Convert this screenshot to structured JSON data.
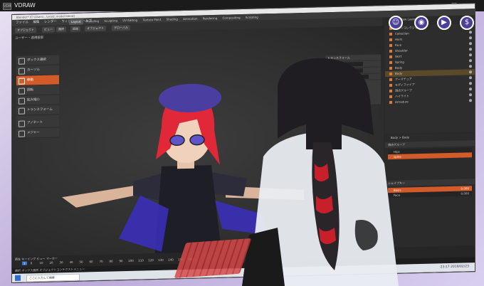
{
  "window": {
    "title": "VDRAW",
    "icon_label": "VDR"
  },
  "controls": {
    "minimize": "—",
    "maximize": "□",
    "close": "✕"
  },
  "blender": {
    "file_title": "Blender* [C:\\Users\\...\\vroid_model.blend]",
    "menu": [
      "ファイル",
      "編集",
      "レンダー",
      "ウィンドウ",
      "ヘルプ"
    ],
    "workspace_tabs": [
      "Layout",
      "Modeling",
      "Sculpting",
      "UV Editing",
      "Texture Paint",
      "Shading",
      "Animation",
      "Rendering",
      "Compositing",
      "Scripting"
    ],
    "active_tab": "Layout",
    "header": {
      "mode": "オブジェクト",
      "view": "ビュー",
      "select": "選択",
      "add": "追加",
      "object": "オブジェクト",
      "global": "グローバル",
      "scene": "Scene",
      "view_layer": "View Layer"
    },
    "viewport_info": "ユーザー・透視投影",
    "tools": [
      {
        "label": "ボックス選択",
        "active": false
      },
      {
        "label": "カーソル",
        "active": false
      },
      {
        "label": "移動",
        "active": true
      },
      {
        "label": "回転",
        "active": false
      },
      {
        "label": "拡大縮小",
        "active": false
      },
      {
        "label": "トランスフォーム",
        "active": false
      },
      {
        "label": "アノテート",
        "active": false
      },
      {
        "label": "メジャー",
        "active": false
      }
    ],
    "npanel": {
      "title": "トランスフォーム",
      "row1": "位置",
      "row2": "回転",
      "row3": "スケール"
    },
    "outliner": [
      {
        "label": "シーンコレクション",
        "sel": false
      },
      {
        "label": "Collection",
        "sel": false
      },
      {
        "label": "Hairs",
        "sel": false
      },
      {
        "label": "Face",
        "sel": false
      },
      {
        "label": "Shoulder",
        "sel": false
      },
      {
        "label": "Skirt",
        "sel": false
      },
      {
        "label": "Spring",
        "sel": false
      },
      {
        "label": "Body",
        "sel": false
      },
      {
        "label": "Body",
        "sel": true
      },
      {
        "label": "アーマチュア",
        "sel": false
      },
      {
        "label": "モディファイア",
        "sel": false
      },
      {
        "label": "頂点グループ",
        "sel": false
      },
      {
        "label": "ハイライト",
        "sel": false
      },
      {
        "label": "Armature",
        "sel": false
      }
    ],
    "props": {
      "breadcrumb": "Body > Body",
      "section1": "頂点グループ",
      "vgroups": [
        "Hips",
        "spine"
      ],
      "section2": "シェイプキー",
      "shapekeys": [
        "Basis",
        "Face"
      ],
      "shapekey_value": "0.000"
    },
    "timeline": {
      "label": "再生  キーイング  ビュー  マーカー",
      "frames": [
        "0",
        "10",
        "20",
        "30",
        "40",
        "50",
        "60",
        "70",
        "80",
        "90",
        "100",
        "110",
        "120",
        "130",
        "140",
        "150",
        "160"
      ],
      "current": "1"
    },
    "status": "選択  ボックス選択  オブジェクトコンテクストメニュー",
    "taskbar_search": "ここに入力して検索",
    "clock": "23:17  2019/02/23"
  },
  "vr_buttons": [
    "person-icon",
    "camera-icon",
    "video-icon",
    "dollar-icon"
  ],
  "colors": {
    "accent": "#d35b2a",
    "vr": "#4b3f9a"
  }
}
